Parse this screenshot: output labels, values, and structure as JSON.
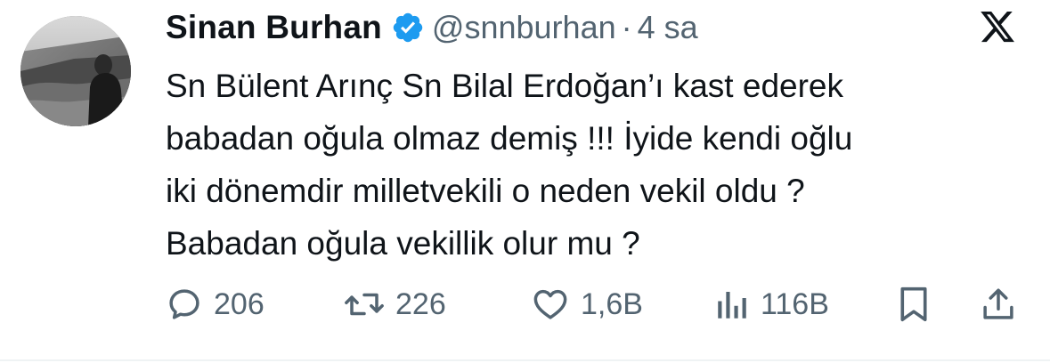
{
  "author": {
    "name": "Sinan Burhan",
    "handle": "@snnburhan",
    "separator": "·",
    "time": "4 sa",
    "verified": true
  },
  "platform_icon": "x-logo-icon",
  "tweet": {
    "lines": [
      "Sn Bülent Arınç Sn Bilal Erdoğan’ı kast ederek",
      "babadan oğula olmaz demiş !!! İyide kendi oğlu",
      "iki dönemdir milletvekili o neden vekil oldu ?",
      "Babadan oğula vekillik olur mu ?"
    ]
  },
  "actions": {
    "replies": {
      "icon": "reply-icon",
      "count": "206"
    },
    "retweets": {
      "icon": "retweet-icon",
      "count": "226"
    },
    "likes": {
      "icon": "heart-icon",
      "count": "1,6B"
    },
    "views": {
      "icon": "views-icon",
      "count": "116B"
    },
    "bookmark": {
      "icon": "bookmark-icon"
    },
    "share": {
      "icon": "share-icon"
    }
  },
  "colors": {
    "text": "#0f1419",
    "secondary": "#536471",
    "verified": "#1d9bf0"
  }
}
